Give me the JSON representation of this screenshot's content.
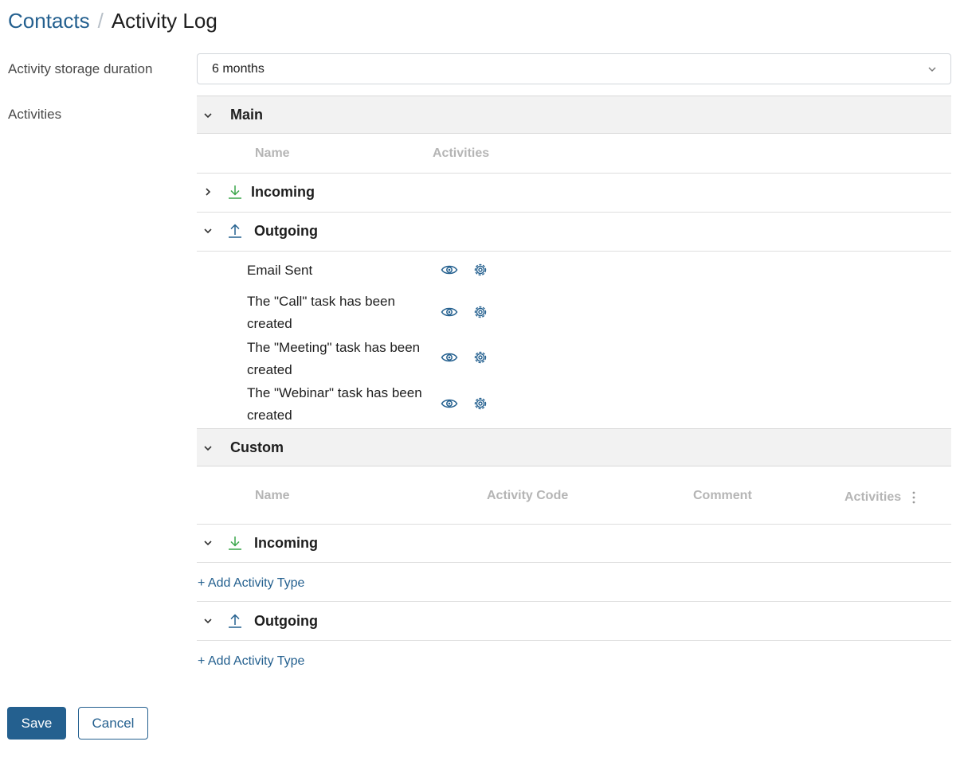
{
  "breadcrumb": {
    "parent": "Contacts",
    "separator": "/",
    "current": "Activity Log"
  },
  "storage": {
    "label": "Activity storage duration",
    "value": "6 months"
  },
  "activities_label": "Activities",
  "main": {
    "title": "Main",
    "columns": {
      "name": "Name",
      "activities": "Activities"
    },
    "incoming": {
      "label": "Incoming",
      "expanded": false
    },
    "outgoing": {
      "label": "Outgoing",
      "expanded": true,
      "items": [
        "Email Sent",
        "The \"Call\" task has been created",
        "The \"Meeting\" task has been created",
        "The \"Webinar\" task has been created"
      ]
    }
  },
  "custom": {
    "title": "Custom",
    "columns": {
      "name": "Name",
      "code": "Activity Code",
      "comment": "Comment",
      "activities": "Activities"
    },
    "incoming": {
      "label": "Incoming",
      "add_label": "+ Add Activity Type"
    },
    "outgoing": {
      "label": "Outgoing",
      "add_label": "+ Add Activity Type"
    }
  },
  "buttons": {
    "save": "Save",
    "cancel": "Cancel"
  },
  "colors": {
    "accent": "#24608f",
    "incoming_icon": "#3aa64a",
    "outgoing_icon": "#24608f",
    "action_icon": "#24608f"
  }
}
